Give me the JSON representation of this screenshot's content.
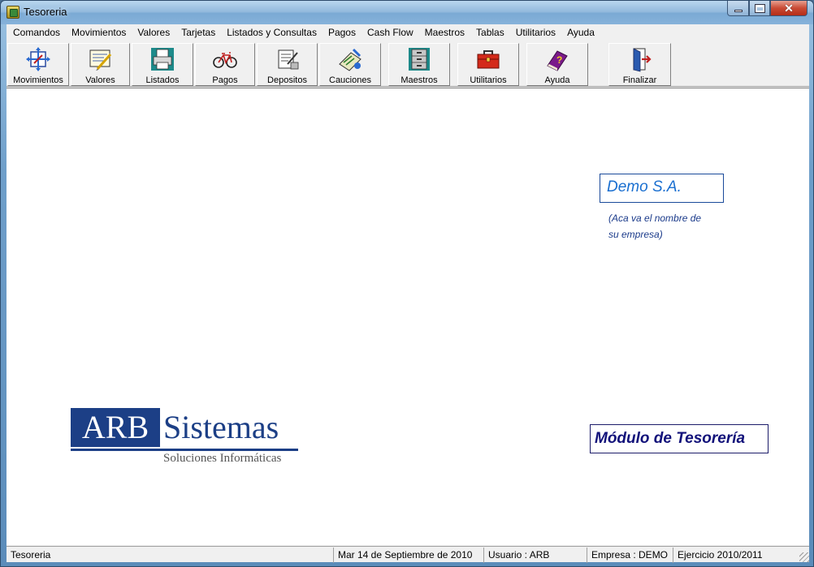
{
  "window": {
    "title": "Tesoreria"
  },
  "menu": [
    {
      "label": "Comandos"
    },
    {
      "label": "Movimientos"
    },
    {
      "label": "Valores"
    },
    {
      "label": "Tarjetas"
    },
    {
      "label": "Listados y Consultas"
    },
    {
      "label": "Pagos"
    },
    {
      "label": "Cash Flow"
    },
    {
      "label": "Maestros"
    },
    {
      "label": "Tablas"
    },
    {
      "label": "Utilitarios"
    },
    {
      "label": "Ayuda"
    }
  ],
  "toolbar": [
    {
      "label": "Movimientos",
      "icon": "movements-icon"
    },
    {
      "label": "Valores",
      "icon": "values-icon"
    },
    {
      "label": "Listados",
      "icon": "printer-icon"
    },
    {
      "label": "Pagos",
      "icon": "bicycle-icon"
    },
    {
      "label": "Depositos",
      "icon": "deposit-icon"
    },
    {
      "label": "Cauciones",
      "icon": "bonds-icon"
    },
    {
      "label": "Maestros",
      "icon": "cabinet-icon"
    },
    {
      "label": "Utilitarios",
      "icon": "toolbox-icon"
    },
    {
      "label": "Ayuda",
      "icon": "help-book-icon"
    },
    {
      "label": "Finalizar",
      "icon": "exit-door-icon"
    }
  ],
  "main": {
    "company_name": "Demo S.A.",
    "company_note_line1": "(Aca va el nombre de",
    "company_note_line2": "su empresa)",
    "logo_part1": "ARB",
    "logo_part2": "Sistemas",
    "logo_tagline": "Soluciones Informáticas",
    "module_label": "Módulo de Tesorería"
  },
  "status": {
    "app": "Tesoreria",
    "date": "Mar 14 de Septiembre de 2010",
    "user": "Usuario : ARB",
    "company": "Empresa : DEMO",
    "period": "Ejercicio 2010/2011"
  },
  "colors": {
    "logo_blue": "#1c3f86",
    "company_text": "#1a6fd0",
    "module_text": "#12127a"
  }
}
